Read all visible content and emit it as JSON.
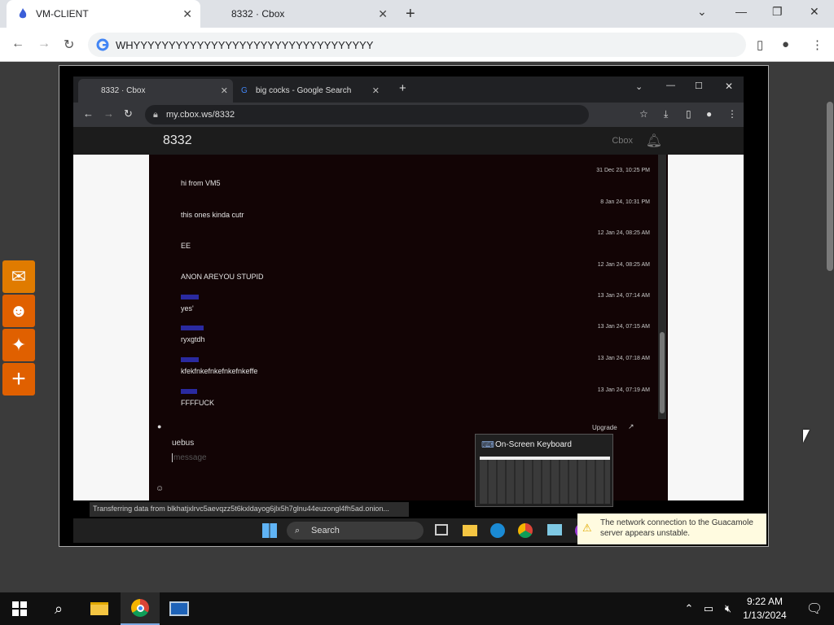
{
  "browser": {
    "tabs": [
      {
        "label": "VM-CLIENT",
        "active": true
      },
      {
        "label": "8332 · Cbox",
        "active": false
      }
    ],
    "address": "WHYYYYYYYYYYYYYYYYYYYYYYYYYYYYYYYYYY"
  },
  "share_buttons": [
    "mail-icon",
    "reddit-icon",
    "twitter-icon",
    "plus-icon"
  ],
  "vm": {
    "tabs": [
      {
        "label": "8332 · Cbox",
        "active": true
      },
      {
        "label": "big cocks - Google Search",
        "active": false
      }
    ],
    "url": "my.cbox.ws/8332",
    "page_title": "8332",
    "brand": "Cbox",
    "messages": [
      {
        "text": "hi from VM5",
        "time": "31 Dec 23, 10:25 PM"
      },
      {
        "text": "this ones kinda cutr",
        "time": "8 Jan 24, 10:31 PM"
      },
      {
        "text": "EE",
        "time": "12 Jan 24, 08:25 AM"
      },
      {
        "text": "ANON AREYOU STUPID",
        "time": "12 Jan 24, 08:25 AM"
      },
      {
        "text": "yes'",
        "time": "13 Jan 24, 07:14 AM"
      },
      {
        "text": "ryxgtdh",
        "time": "13 Jan 24, 07:15 AM"
      },
      {
        "text": "kfekfnkefnkefnkefnkeffe",
        "time": "13 Jan 24, 07:18 AM"
      },
      {
        "text": "FFFFUCK",
        "time": "13 Jan 24, 07:19 AM"
      }
    ],
    "upgrade": "Upgrade",
    "nickname": "uebus",
    "message_placeholder": "message",
    "osk_title": "On-Screen Keyboard",
    "status_bar": "Transferring data from blkhatjxlrvc5aevqzz5t6kxldayog6jlx5h7glnu44euzongl4fh5ad.onion...",
    "taskbar_search": "Search",
    "warning": "The network connection to the Guacamole server appears unstable."
  },
  "taskbar": {
    "time": "9:22 AM",
    "date": "1/13/2024"
  }
}
